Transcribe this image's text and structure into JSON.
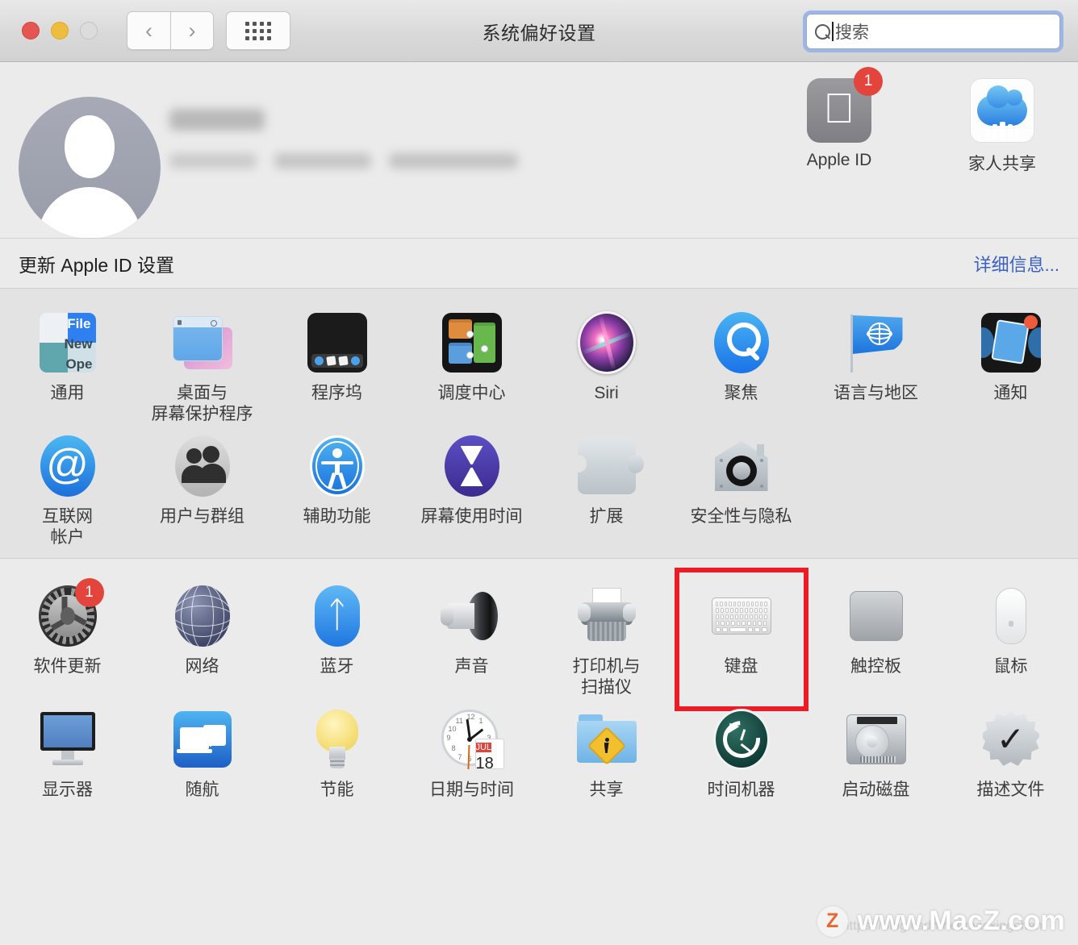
{
  "window": {
    "title": "系统偏好设置",
    "traffic_lights": [
      "close",
      "minimize",
      "zoom"
    ],
    "nav": {
      "back": "‹",
      "forward": "›",
      "grid_label": "show-all-grid"
    },
    "search": {
      "placeholder": "搜索",
      "value": "",
      "icon": "search-icon"
    }
  },
  "account": {
    "avatar_icon": "user-avatar-placeholder",
    "name_redacted": "",
    "detail_redacted": "",
    "top_items": [
      {
        "label": "Apple ID",
        "icon": "apple-logo-icon",
        "badge": "1"
      },
      {
        "label": "家人共享",
        "icon": "family-sharing-cloud-icon",
        "badge": ""
      }
    ]
  },
  "update_row": {
    "message": "更新 Apple ID 设置",
    "link": "详细信息..."
  },
  "sections": [
    {
      "name": "personal",
      "rows": [
        [
          {
            "label": "通用",
            "icon": "general-icon",
            "badge": ""
          },
          {
            "label": "桌面与\n屏幕保护程序",
            "icon": "desktop-screensaver-icon",
            "badge": ""
          },
          {
            "label": "程序坞",
            "icon": "dock-icon",
            "badge": ""
          },
          {
            "label": "调度中心",
            "icon": "mission-control-icon",
            "badge": ""
          },
          {
            "label": "Siri",
            "icon": "siri-icon",
            "badge": ""
          },
          {
            "label": "聚焦",
            "icon": "spotlight-icon",
            "badge": ""
          },
          {
            "label": "语言与地区",
            "icon": "language-region-flag-icon",
            "badge": ""
          },
          {
            "label": "通知",
            "icon": "notifications-icon",
            "badge": ""
          }
        ],
        [
          {
            "label": "互联网\n帐户",
            "icon": "internet-accounts-at-icon",
            "badge": ""
          },
          {
            "label": "用户与群组",
            "icon": "users-groups-icon",
            "badge": ""
          },
          {
            "label": "辅助功能",
            "icon": "accessibility-icon",
            "badge": ""
          },
          {
            "label": "屏幕使用时间",
            "icon": "screen-time-hourglass-icon",
            "badge": ""
          },
          {
            "label": "扩展",
            "icon": "extensions-puzzle-icon",
            "badge": ""
          },
          {
            "label": "安全性与隐私",
            "icon": "security-privacy-icon",
            "badge": ""
          }
        ]
      ]
    },
    {
      "name": "hardware",
      "rows": [
        [
          {
            "label": "软件更新",
            "icon": "software-update-gear-icon",
            "badge": "1"
          },
          {
            "label": "网络",
            "icon": "network-globe-icon",
            "badge": ""
          },
          {
            "label": "蓝牙",
            "icon": "bluetooth-icon",
            "badge": ""
          },
          {
            "label": "声音",
            "icon": "sound-speaker-icon",
            "badge": ""
          },
          {
            "label": "打印机与\n扫描仪",
            "icon": "printers-scanners-icon",
            "badge": ""
          },
          {
            "label": "键盘",
            "icon": "keyboard-icon",
            "badge": "",
            "highlighted": true
          },
          {
            "label": "触控板",
            "icon": "trackpad-icon",
            "badge": ""
          },
          {
            "label": "鼠标",
            "icon": "mouse-icon",
            "badge": ""
          }
        ],
        [
          {
            "label": "显示器",
            "icon": "displays-icon",
            "badge": ""
          },
          {
            "label": "随航",
            "icon": "sidecar-icon",
            "badge": ""
          },
          {
            "label": "节能",
            "icon": "energy-saver-bulb-icon",
            "badge": ""
          },
          {
            "label": "日期与时间",
            "icon": "date-time-clock-icon",
            "badge": "",
            "calendar_month": "JUL",
            "calendar_day": "18"
          },
          {
            "label": "共享",
            "icon": "sharing-folder-icon",
            "badge": ""
          },
          {
            "label": "时间机器",
            "icon": "time-machine-icon",
            "badge": ""
          },
          {
            "label": "启动磁盘",
            "icon": "startup-disk-icon",
            "badge": ""
          },
          {
            "label": "描述文件",
            "icon": "profiles-check-icon",
            "badge": ""
          }
        ]
      ]
    }
  ],
  "watermark": {
    "badge": "Z",
    "text": "www.MacZ.com",
    "subtext": "https://blog.csdn.net/macxingchen"
  },
  "colors": {
    "highlight_red": "#ec1c24",
    "badge_red": "#e3453c",
    "link_blue": "#3b60c4",
    "focus_ring": "#9cb6e8",
    "window_bg": "#ebebeb",
    "band_bg": "#e3e3e3"
  }
}
